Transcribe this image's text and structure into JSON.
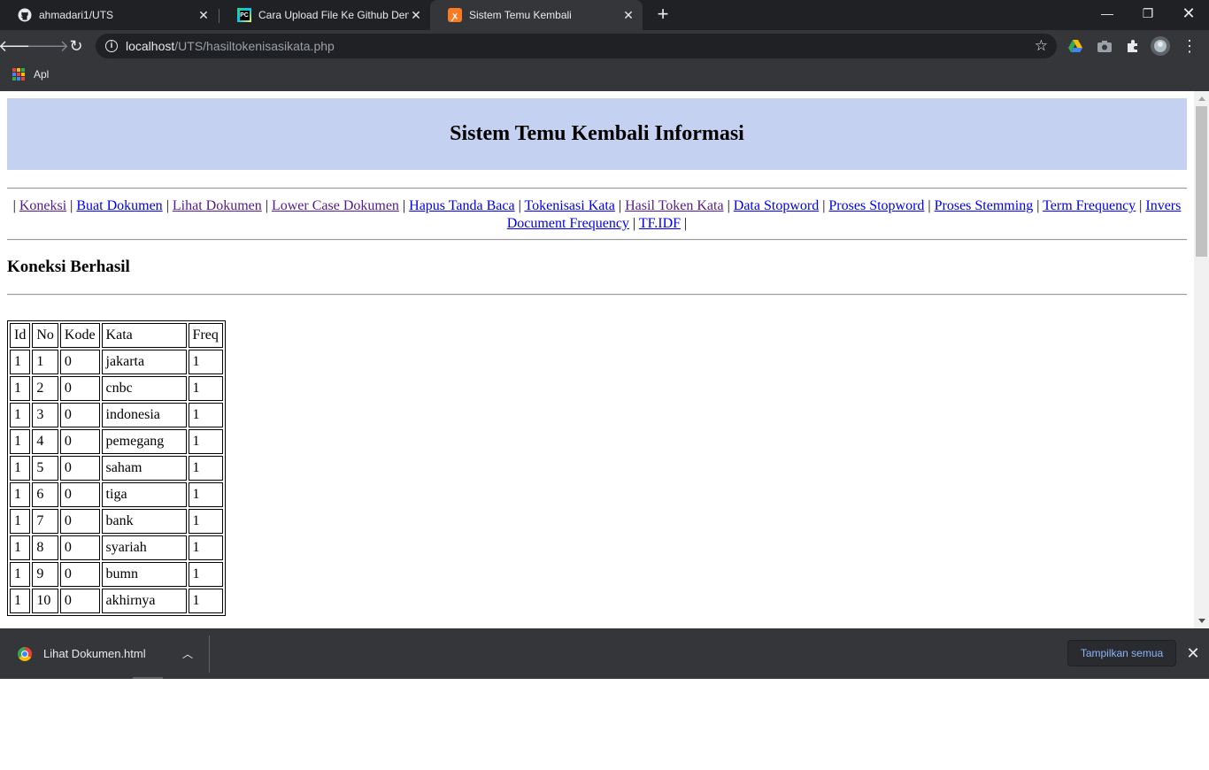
{
  "browser": {
    "tabs": [
      {
        "title": "ahmadari1/UTS",
        "icon": "github-icon"
      },
      {
        "title": "Cara Upload File Ke Github Deng",
        "icon": "pycharm-icon"
      },
      {
        "title": "Sistem Temu Kembali",
        "icon": "xampp-icon",
        "active": true
      }
    ],
    "url_host": "localhost",
    "url_path": "/UTS/hasiltokenisasikata.php",
    "bookmarks_label": "Apl"
  },
  "page": {
    "title": "Sistem Temu Kembali Informasi",
    "nav": [
      {
        "label": "Koneksi",
        "visited": true
      },
      {
        "label": "Buat Dokumen",
        "visited": false
      },
      {
        "label": "Lihat Dokumen",
        "visited": true
      },
      {
        "label": "Lower Case Dokumen",
        "visited": true
      },
      {
        "label": "Hapus Tanda Baca",
        "visited": false
      },
      {
        "label": "Tokenisasi Kata",
        "visited": false
      },
      {
        "label": "Hasil Token Kata",
        "visited": true
      },
      {
        "label": "Data Stopword",
        "visited": false
      },
      {
        "label": "Proses Stopword",
        "visited": false
      },
      {
        "label": "Proses Stemming",
        "visited": false
      },
      {
        "label": "Term Frequency",
        "visited": false
      },
      {
        "label": "Invers Document Frequency",
        "visited": false
      },
      {
        "label": "TF.IDF",
        "visited": false
      }
    ],
    "status": "Koneksi Berhasil",
    "table": {
      "headers": [
        "Id",
        "No",
        "Kode",
        "Kata",
        "Freq"
      ],
      "rows": [
        [
          "1",
          "1",
          "0",
          "jakarta",
          "1"
        ],
        [
          "1",
          "2",
          "0",
          "cnbc",
          "1"
        ],
        [
          "1",
          "3",
          "0",
          "indonesia",
          "1"
        ],
        [
          "1",
          "4",
          "0",
          "pemegang",
          "1"
        ],
        [
          "1",
          "5",
          "0",
          "saham",
          "1"
        ],
        [
          "1",
          "6",
          "0",
          "tiga",
          "1"
        ],
        [
          "1",
          "7",
          "0",
          "bank",
          "1"
        ],
        [
          "1",
          "8",
          "0",
          "syariah",
          "1"
        ],
        [
          "1",
          "9",
          "0",
          "bumn",
          "1"
        ],
        [
          "1",
          "10",
          "0",
          "akhirnya",
          "1"
        ]
      ]
    }
  },
  "downloads": {
    "file_name": "Lihat Dokumen.html",
    "show_all_label": "Tampilkan semua"
  },
  "colors": {
    "banner": "#c5d1f0",
    "link": "#0000ee",
    "visited_link": "#551a8b",
    "chrome_dark": "#202124",
    "chrome_toolbar": "#35363a"
  }
}
